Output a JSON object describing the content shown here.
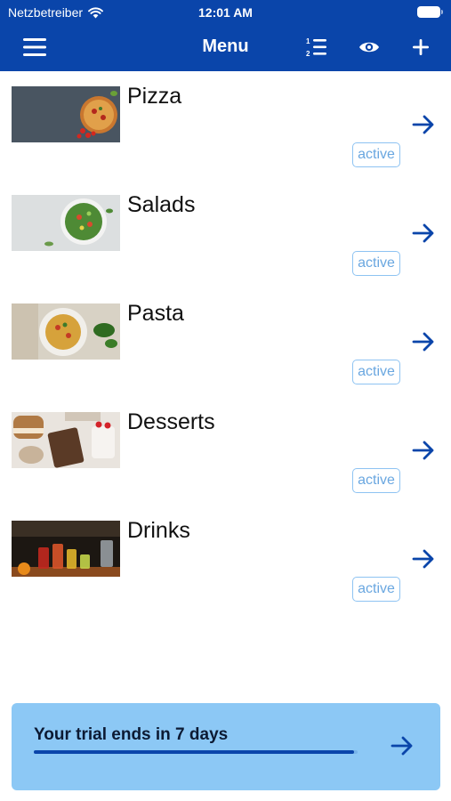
{
  "status_bar": {
    "carrier": "Netzbetreiber",
    "time": "12:01 AM"
  },
  "nav": {
    "title": "Menu"
  },
  "categories": [
    {
      "title": "Pizza",
      "status": "active"
    },
    {
      "title": "Salads",
      "status": "active"
    },
    {
      "title": "Pasta",
      "status": "active"
    },
    {
      "title": "Desserts",
      "status": "active"
    },
    {
      "title": "Drinks",
      "status": "active"
    }
  ],
  "trial": {
    "text": "Your trial ends in 7 days",
    "progress": 0.99
  },
  "colors": {
    "accent": "#0a45aa",
    "badge_border": "#8ec3f2",
    "badge_text": "#6aa7e0",
    "trial_bg": "#8cc8f5"
  },
  "icons": {
    "menu": "hamburger-icon",
    "list": "numbered-list-icon",
    "preview": "eye-icon",
    "add": "plus-icon",
    "row_action": "arrow-right-icon"
  }
}
